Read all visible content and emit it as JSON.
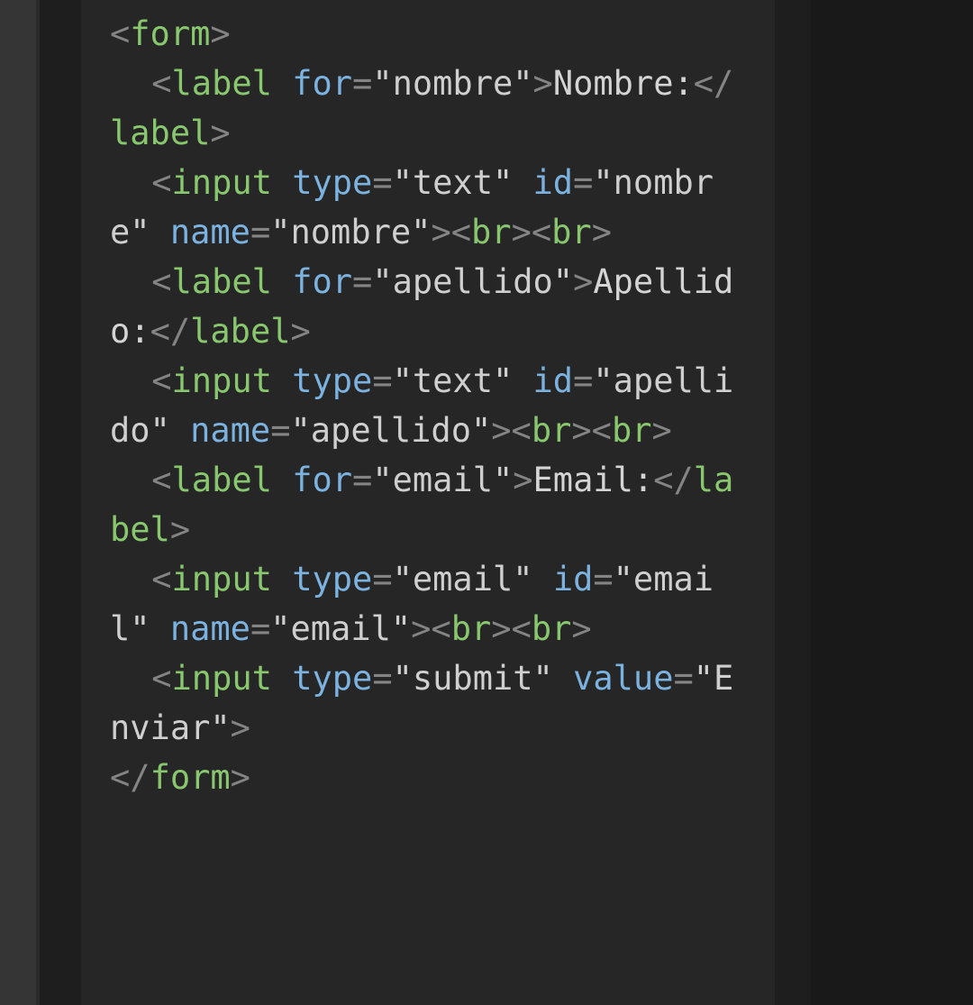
{
  "code": {
    "p": {
      "lt": "<",
      "gt": ">",
      "lts": "</",
      "eq": "=",
      "ob": "><"
    },
    "t": {
      "form": "form",
      "label": "label",
      "input": "input",
      "br": "br"
    },
    "a": {
      "for": "for",
      "type": "type",
      "id": "id",
      "name": "name",
      "value": "value"
    },
    "v": {
      "nombre": "\"nombre\"",
      "apellido": "\"apellido\"",
      "email_s": "\"email\"",
      "text": "\"text\"",
      "submit": "\"submit\"",
      "enviar": "\"Enviar\""
    },
    "txt": {
      "nombre": "Nombre:",
      "apellido": "Apellido:",
      "email": "Email:"
    },
    "sp": " ",
    "ind": "   "
  }
}
